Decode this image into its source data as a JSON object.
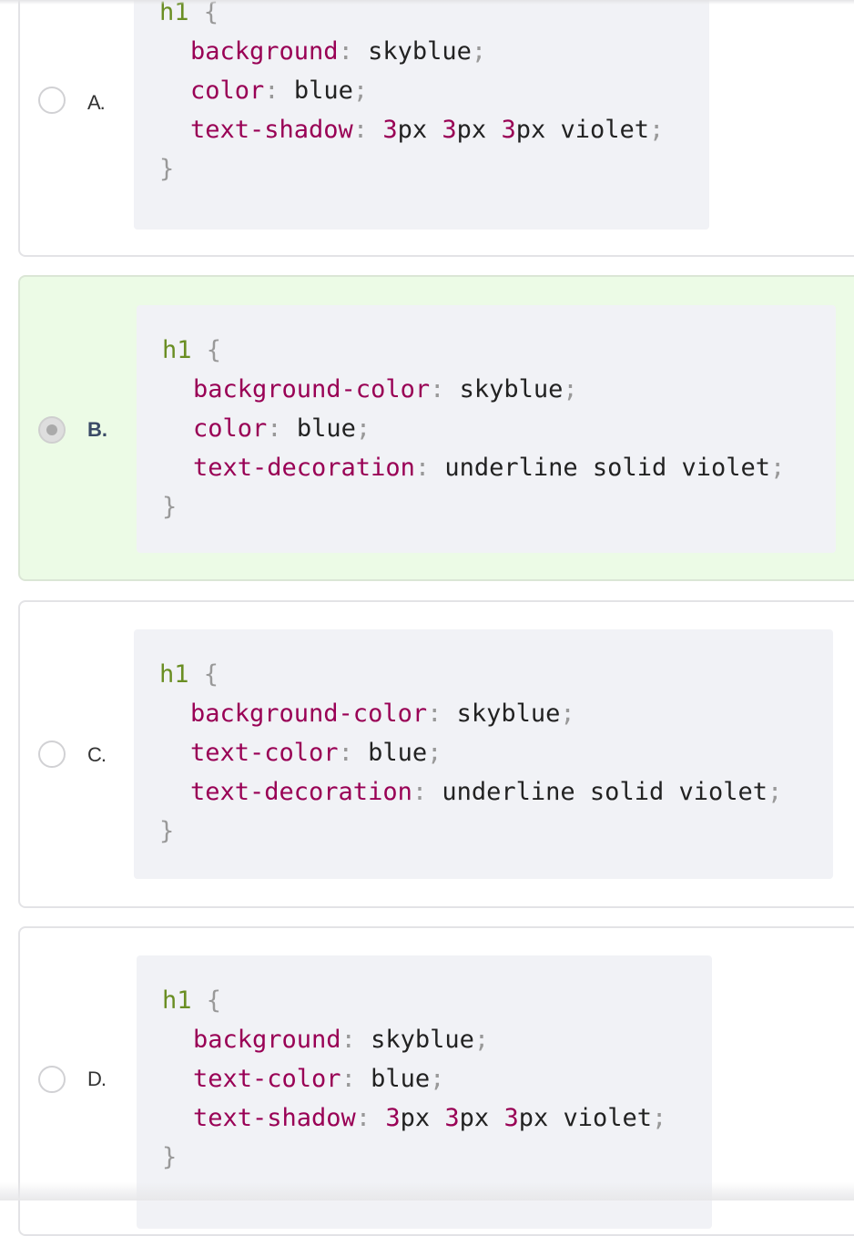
{
  "options": [
    {
      "letter": "A.",
      "selected": false,
      "code": {
        "selector": "h1",
        "open": " {",
        "decls": [
          {
            "prop": "background",
            "value": "skyblue"
          },
          {
            "prop": "color",
            "value": "blue"
          },
          {
            "prop": "text-shadow",
            "parts": [
              "3",
              "px ",
              "3",
              "px ",
              "3",
              "px violet"
            ]
          }
        ],
        "close": "}"
      }
    },
    {
      "letter": "B.",
      "selected": true,
      "code": {
        "selector": "h1",
        "open": " {",
        "decls": [
          {
            "prop": "background-color",
            "value": "skyblue"
          },
          {
            "prop": "color",
            "value": "blue"
          },
          {
            "prop": "text-decoration",
            "value": "underline solid violet"
          }
        ],
        "close": "}"
      }
    },
    {
      "letter": "C.",
      "selected": false,
      "code": {
        "selector": "h1",
        "open": " {",
        "decls": [
          {
            "prop": "background-color",
            "value": "skyblue"
          },
          {
            "prop": "text-color",
            "value": "blue"
          },
          {
            "prop": "text-decoration",
            "value": "underline solid violet"
          }
        ],
        "close": "}"
      }
    },
    {
      "letter": "D.",
      "selected": false,
      "code": {
        "selector": "h1",
        "open": " {",
        "decls": [
          {
            "prop": "background",
            "value": "skyblue"
          },
          {
            "prop": "text-color",
            "value": "blue"
          },
          {
            "prop": "text-shadow",
            "parts": [
              "3",
              "px ",
              "3",
              "px ",
              "3",
              "px violet"
            ]
          }
        ],
        "close": "}"
      }
    }
  ],
  "punctuation": {
    "colon": ":",
    "semicolon": ";"
  },
  "colors": {
    "selected_background": "#ecfbe6",
    "code_background": "#f1f2f6",
    "selector": "#6a8e23",
    "property": "#990055",
    "punctuation": "#999999"
  }
}
